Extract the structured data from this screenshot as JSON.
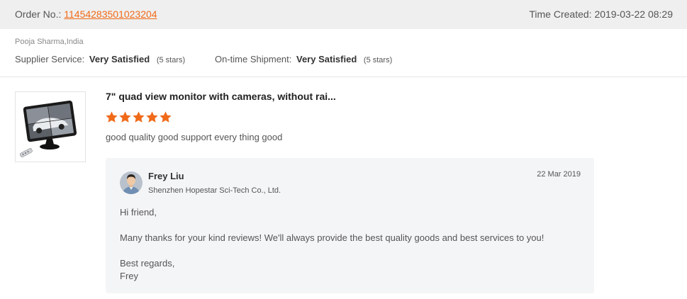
{
  "order": {
    "label": "Order No.:",
    "number": "11454283501023204",
    "time_label": "Time Created:",
    "time_value": "2019-03-22 08:29"
  },
  "buyer": {
    "name": "Pooja Sharma,India"
  },
  "ratings": {
    "supplier": {
      "label": "Supplier Service:",
      "value": "Very Satisfied",
      "stars_text": "(5 stars)"
    },
    "shipment": {
      "label": "On-time Shipment:",
      "value": "Very Satisfied",
      "stars_text": "(5 stars)"
    }
  },
  "product": {
    "title": "7\" quad view monitor with cameras, without rai...",
    "rating": 5,
    "rating_max": 5,
    "review": "good quality good support every thing good"
  },
  "reply": {
    "name": "Frey Liu",
    "company": "Shenzhen Hopestar Sci-Tech Co., Ltd.",
    "date": "22 Mar 2019",
    "greeting": "Hi friend,",
    "message": "Many thanks for your kind reviews!  We'll always provide the best quality goods and best services to you!",
    "signoff": "Best regards,",
    "signature": "Frey"
  },
  "colors": {
    "accent": "#f06a19",
    "star": "#f06a19",
    "header_bg": "#efefef",
    "reply_bg": "#f4f5f7"
  },
  "icons": {
    "star": "star-icon",
    "avatar": "avatar-icon",
    "product": "monitor-product-image"
  }
}
